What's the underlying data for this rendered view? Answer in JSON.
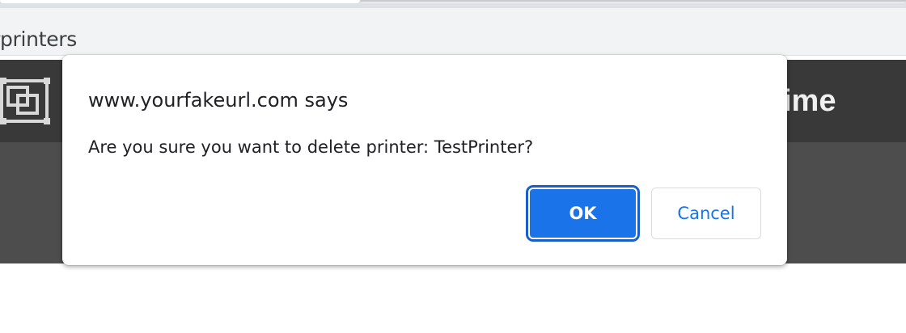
{
  "browser": {
    "url_visible": "rprinters"
  },
  "page": {
    "header_title_fragment": "ime",
    "logo_icon": "frame-icon"
  },
  "dialog": {
    "title": "www.yourfakeurl.com says",
    "message": "Are you sure you want to delete printer: TestPrinter?",
    "ok_label": "OK",
    "cancel_label": "Cancel"
  },
  "colors": {
    "primary": "#1a73e8",
    "header_bg": "#393939",
    "subbar_bg": "#4d4d4d"
  }
}
